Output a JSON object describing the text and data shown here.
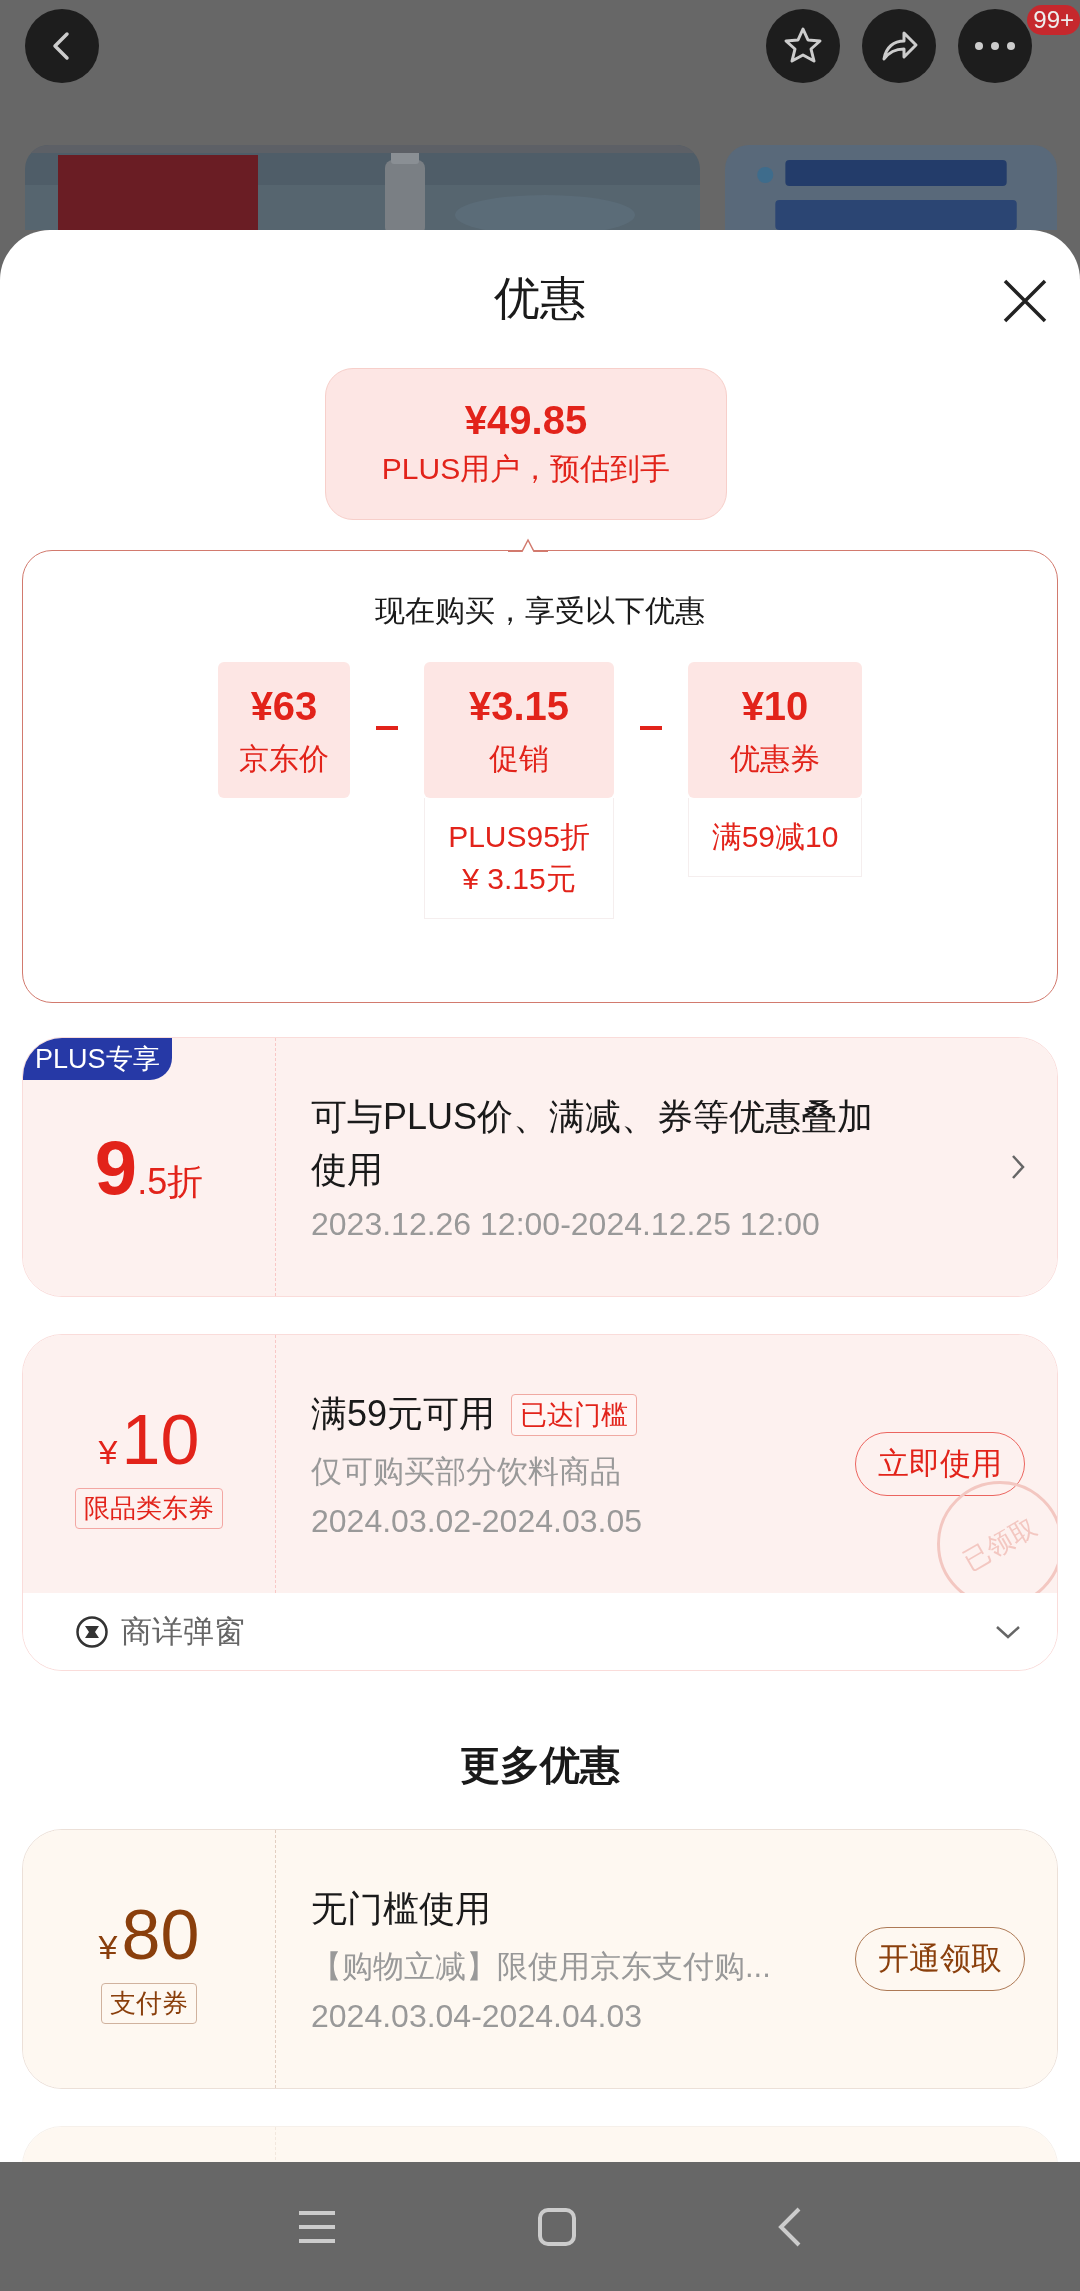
{
  "top_bar": {
    "badge": "99+"
  },
  "sheet": {
    "title": "优惠"
  },
  "estimate": {
    "price": "¥49.85",
    "caption": "PLUS用户，预估到手"
  },
  "breakdown": {
    "heading": "现在购买，享受以下优惠",
    "items": [
      {
        "amount": "¥63",
        "label": "京东价"
      },
      {
        "amount": "¥3.15",
        "label": "促销",
        "detail_lines": [
          "PLUS95折",
          "¥ 3.15元"
        ]
      },
      {
        "amount": "¥10",
        "label": "优惠券",
        "detail_lines": [
          "满59减10"
        ]
      }
    ]
  },
  "coupons": [
    {
      "kind": "discount",
      "color": "#e2231a",
      "tag": "PLUS专享",
      "value_main": "9",
      "value_rest": ".5折",
      "title": "可与PLUS价、满减、券等优惠叠加使用",
      "dates": "2023.12.26 12:00-2024.12.25 12:00"
    },
    {
      "kind": "coupon",
      "color": "#e2231a",
      "currency": "¥",
      "amount": "10",
      "type_label": "限品类东券",
      "title": "满59元可用",
      "badge": "已达门槛",
      "subtitle": "仅可购买部分饮料商品",
      "dates": "2024.03.02-2024.03.05",
      "action": "立即使用",
      "stamp": "已领取",
      "footer": "商详弹窗"
    }
  ],
  "more": {
    "title": "更多优惠",
    "coupons": [
      {
        "kind": "coupon",
        "color": "#8a3f0c",
        "currency": "¥",
        "amount": "80",
        "type_label": "支付券",
        "title": "无门槛使用",
        "subtitle": "【购物立减】限使用京东支付购...",
        "dates": "2024.03.04-2024.04.03",
        "action": "开通领取"
      },
      {
        "kind": "coupon"
      }
    ]
  }
}
